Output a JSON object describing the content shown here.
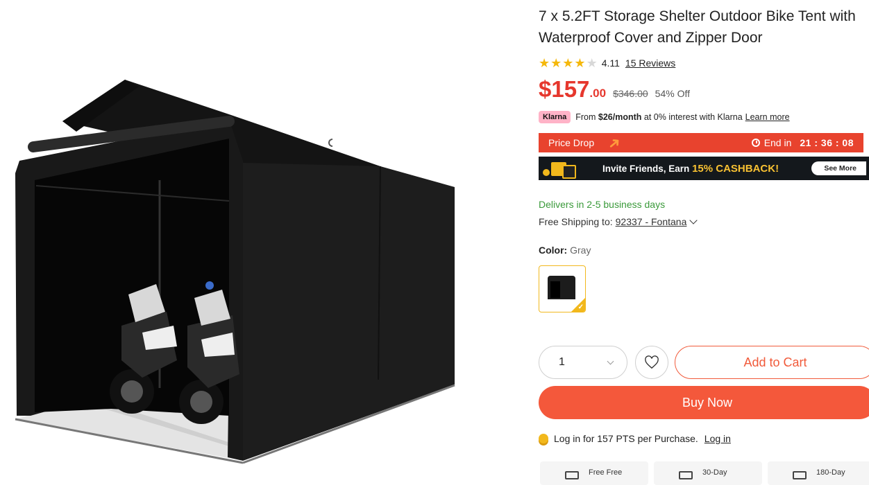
{
  "product": {
    "title": "7 x 5.2FT Storage Shelter Outdoor Bike Tent with Waterproof Cover and Zipper Door",
    "rating": {
      "stars": 4.11,
      "value": "4.11",
      "reviews": "15 Reviews"
    },
    "price": {
      "dollars": "$157",
      "cents": ".00",
      "original": "$346.00",
      "discount": "54% Off"
    },
    "klarna": {
      "badge": "Klarna",
      "prefix": "From",
      "amount": "$26/month",
      "suffix": "at 0% interest with Klarna",
      "link": "Learn more"
    },
    "price_drop": {
      "label": "Price Drop",
      "end_label": "End in",
      "timer": "21 : 36 : 08"
    },
    "invite_banner": {
      "text": "Invite Friends, Earn",
      "highlight": "15% CASHBACK!",
      "button": "See More"
    },
    "delivery": {
      "eta": "Delivers in 2-5 business days",
      "shipping_label": "Free Shipping to:",
      "zip": "92337 - Fontana"
    },
    "color": {
      "label": "Color:",
      "value": "Gray"
    },
    "quantity": "1",
    "buttons": {
      "add_to_cart": "Add to Cart",
      "buy_now": "Buy Now"
    },
    "points": {
      "text": "Log in for 157 PTS per Purchase.",
      "link": "Log in"
    },
    "features": [
      "Free Free",
      "30-Day",
      "180-Day"
    ]
  },
  "colors": {
    "accent": "#e6372d",
    "buy_now": "#f4583b",
    "price_drop": "#e8432e",
    "delivery": "#3a9a3a",
    "gold": "#f2b81c"
  }
}
